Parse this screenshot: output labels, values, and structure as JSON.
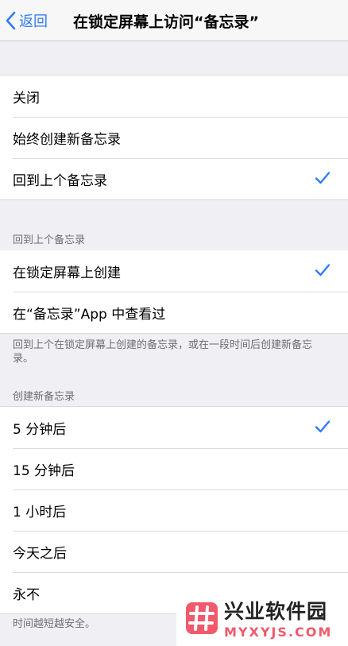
{
  "nav": {
    "back_label": "返回",
    "title": "在锁定屏幕上访问“备忘录”"
  },
  "section1": {
    "items": [
      {
        "label": "关闭",
        "checked": false
      },
      {
        "label": "始终创建新备忘录",
        "checked": false
      },
      {
        "label": "回到上个备忘录",
        "checked": true
      }
    ]
  },
  "section2": {
    "header": "回到上个备忘录",
    "items": [
      {
        "label": "在锁定屏幕上创建",
        "checked": true
      },
      {
        "label": "在“备忘录”App 中查看过",
        "checked": false
      }
    ],
    "footer": "回到上个在锁定屏幕上创建的备忘录，或在一段时间后创建新备忘录。"
  },
  "section3": {
    "header": "创建新备忘录",
    "items": [
      {
        "label": "5 分钟后",
        "checked": true
      },
      {
        "label": "15 分钟后",
        "checked": false
      },
      {
        "label": "1 小时后",
        "checked": false
      },
      {
        "label": "今天之后",
        "checked": false
      },
      {
        "label": "永不",
        "checked": false
      }
    ],
    "footer": "时间越短越安全。"
  },
  "watermark": {
    "cn": "兴业软件园",
    "en": "MYXYJS.COM"
  },
  "colors": {
    "accent": "#2f7cf6",
    "background": "#efeff4",
    "watermark_pink": "#f05a6b"
  }
}
